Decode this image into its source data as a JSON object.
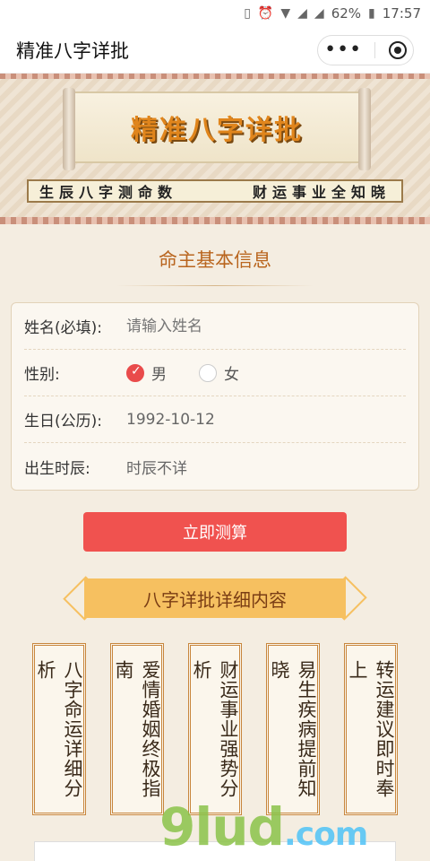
{
  "status_bar": {
    "battery": "62%",
    "time": "17:57"
  },
  "app": {
    "title": "精准八字详批"
  },
  "banner": {
    "headline": "精准八字详批",
    "ribbon_left": "生辰八字测命数",
    "ribbon_right": "财运事业全知晓"
  },
  "form": {
    "section_title": "命主基本信息",
    "name_label": "姓名(必填):",
    "name_placeholder": "请输入姓名",
    "gender_label": "性别:",
    "gender_male": "男",
    "gender_female": "女",
    "gender_selected": "男",
    "birthday_label": "生日(公历):",
    "birthday_value": "1992-10-12",
    "birth_hour_label": "出生时辰:",
    "birth_hour_value": "时辰不详",
    "submit_label": "立即测算"
  },
  "details": {
    "title": "八字详批详细内容",
    "items": [
      "八字命运详细分析",
      "爱情婚姻终极指南",
      "财运事业强势分析",
      "易生疾病提前知晓",
      "转运建议即时奉上"
    ]
  },
  "watermark": {
    "text": "9lud",
    "suffix": ".com"
  },
  "colors": {
    "accent": "#f0524f",
    "gold": "#f6c060",
    "brown_text": "#b9651e"
  }
}
